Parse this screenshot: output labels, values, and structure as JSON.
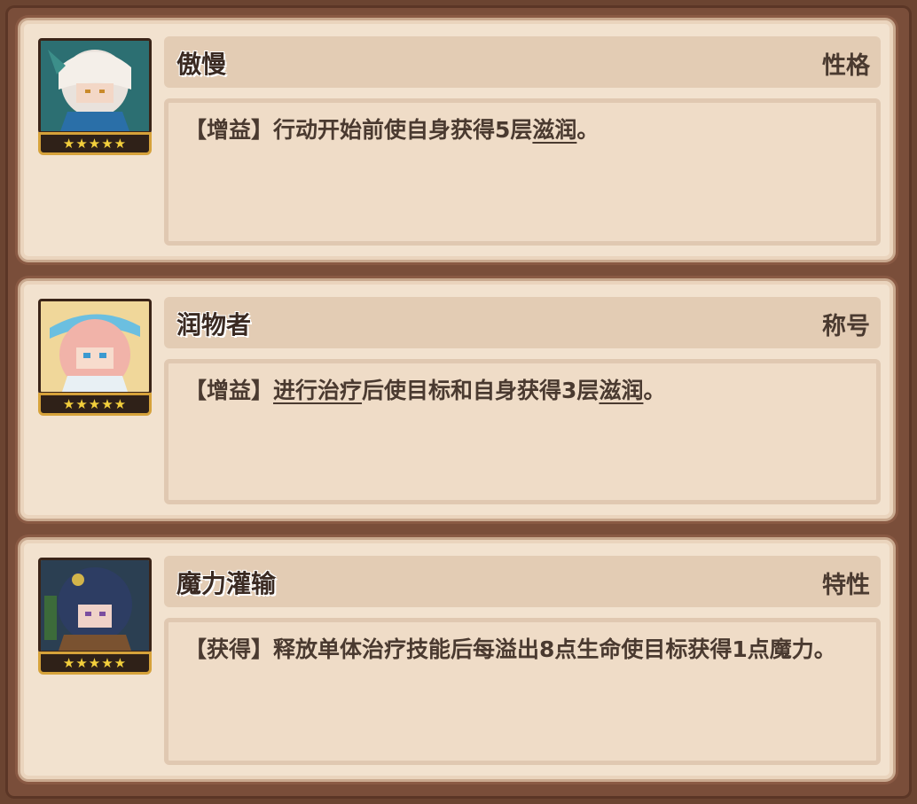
{
  "cards": [
    {
      "name": "傲慢",
      "type": "性格",
      "stars": "★★★★★",
      "desc": [
        {
          "t": "【增益】行动开始前使自身获得5层"
        },
        {
          "u": "滋润"
        },
        {
          "t": "。"
        }
      ]
    },
    {
      "name": "润物者",
      "type": "称号",
      "stars": "★★★★★",
      "desc": [
        {
          "t": "【增益】"
        },
        {
          "u": "进行治疗"
        },
        {
          "t": "后使目标和自身获得3层"
        },
        {
          "u": "滋润"
        },
        {
          "t": "。"
        }
      ]
    },
    {
      "name": "魔力灌输",
      "type": "特性",
      "stars": "★★★★★",
      "desc": [
        {
          "t": "【获得】释放单体治疗技能后每溢出8点生命使目标获得1点魔力。"
        }
      ]
    }
  ]
}
